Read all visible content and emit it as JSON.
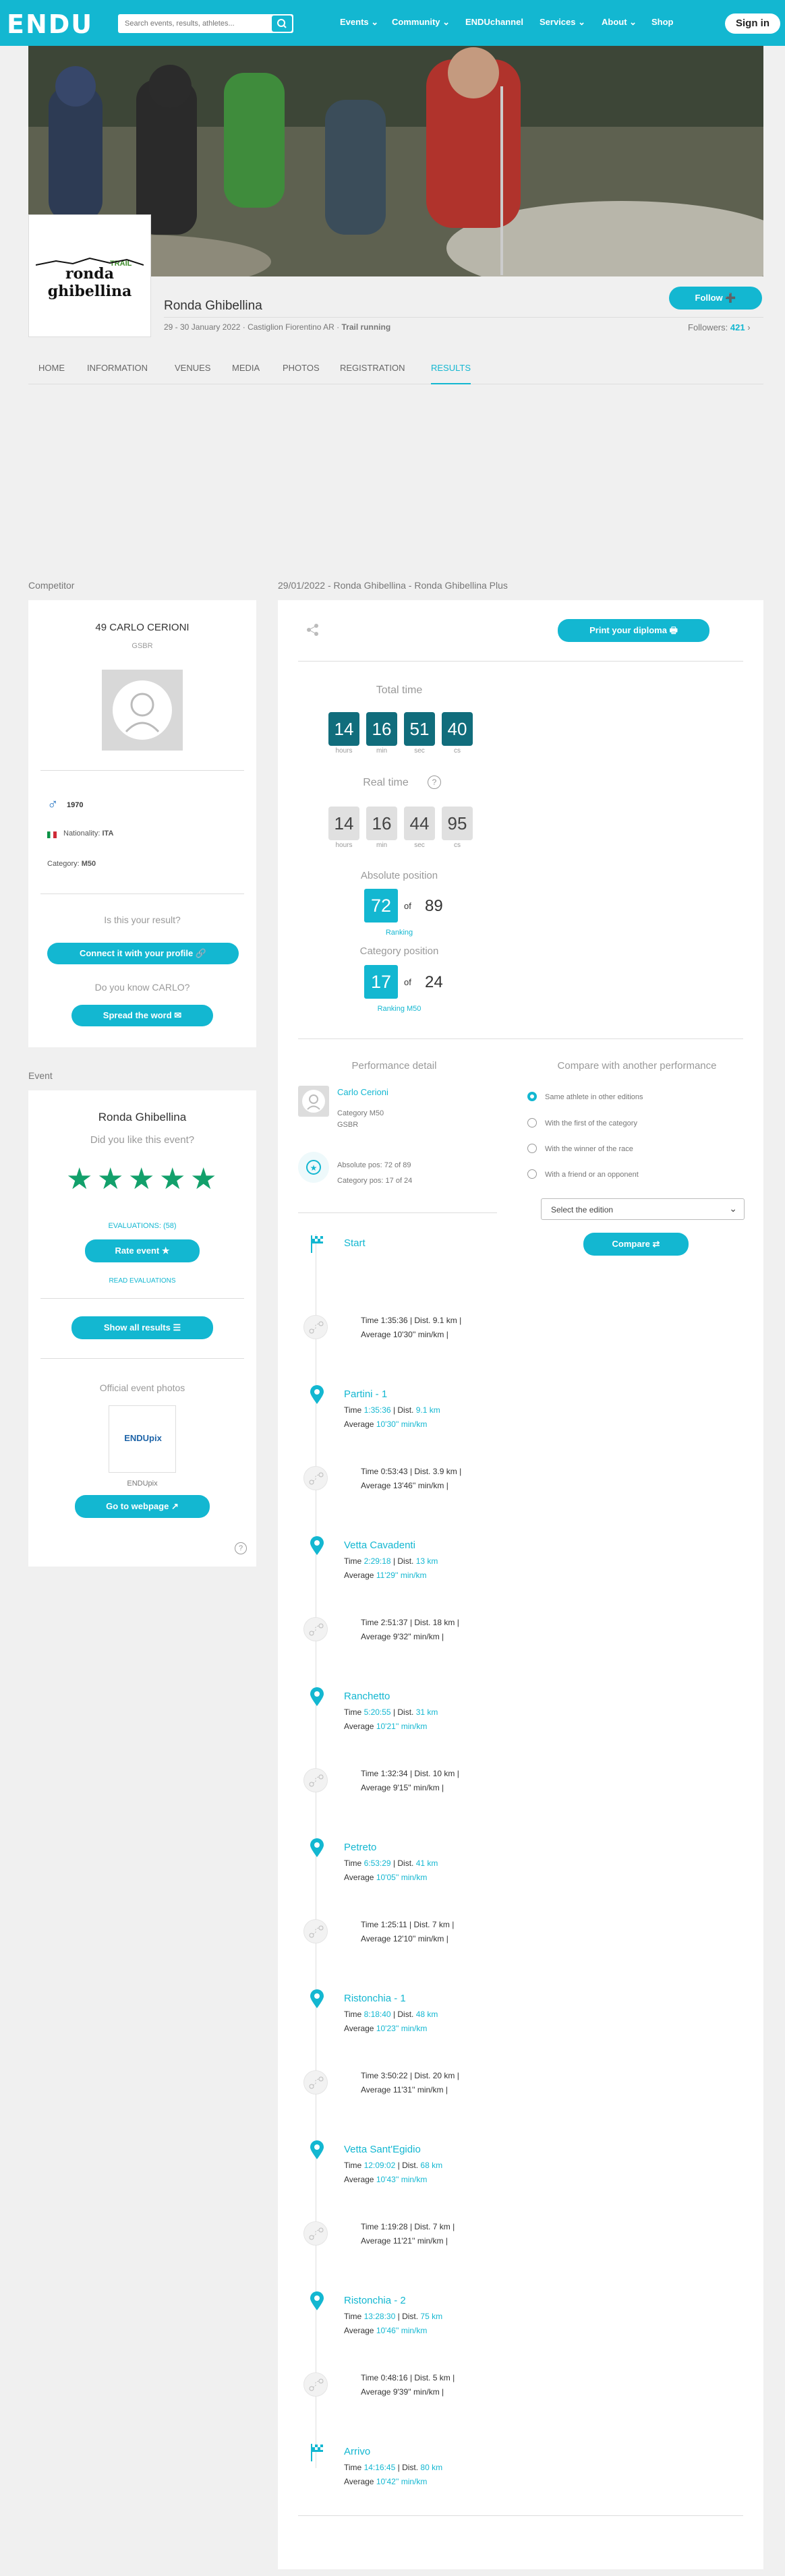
{
  "header": {
    "logo": "ENDU",
    "search_placeholder": "Search events, results, athletes...",
    "nav": [
      "Events",
      "Community",
      "ENDUchannel",
      "Services",
      "About",
      "Shop"
    ],
    "signin": "Sign in"
  },
  "event": {
    "logo_text": "ronda ghibellina",
    "logo_tag": "TRAIL",
    "title": "Ronda Ghibellina",
    "subtitle_prefix": "29 - 30 January 2022 · Castiglion Fiorentino AR · ",
    "subtitle_sport": "Trail running",
    "follow": "Follow",
    "followers_label": "Followers:",
    "followers_count": "421"
  },
  "tabs": [
    "HOME",
    "INFORMATION",
    "VENUES",
    "MEDIA",
    "PHOTOS",
    "REGISTRATION",
    "RESULTS"
  ],
  "competitor": {
    "section": "Competitor",
    "name": "49 CARLO CERIONI",
    "team": "GSBR",
    "year": "1970",
    "nationality_label": "Nationality:",
    "nationality": "ITA",
    "category_label": "Category:",
    "category": "M50",
    "is_your_result": "Is this your result?",
    "connect": "Connect it with your profile",
    "know": "Do you know CARLO?",
    "spread": "Spread the word"
  },
  "event_box": {
    "section": "Event",
    "title": "Ronda Ghibellina",
    "like": "Did you like this event?",
    "evaluations": "EVALUATIONS: (58)",
    "rate": "Rate event",
    "read": "READ EVALUATIONS",
    "show_all": "Show all results",
    "photos": "Official event photos",
    "endupix": "ENDUpix",
    "goto": "Go to webpage",
    "rating": 5
  },
  "result": {
    "header": "29/01/2022 - Ronda Ghibellina - Ronda Ghibellina Plus",
    "print": "Print your diploma",
    "total_time": "Total time",
    "total": [
      "14",
      "16",
      "51",
      "40"
    ],
    "units": [
      "hours",
      "min",
      "sec",
      "cs"
    ],
    "real_time": "Real time",
    "real": [
      "14",
      "16",
      "44",
      "95"
    ],
    "abs_label": "Absolute position",
    "abs_pos": "72",
    "of": "of",
    "abs_total": "89",
    "ranking": "Ranking",
    "cat_label": "Category position",
    "cat_pos": "17",
    "cat_total": "24",
    "ranking_cat": "Ranking M50"
  },
  "performance": {
    "title": "Performance detail",
    "name": "Carlo Cerioni",
    "category": "Category M50",
    "team": "GSBR",
    "abs": "Absolute pos: 72 of 89",
    "cat": "Category pos: 17 of 24"
  },
  "compare": {
    "title": "Compare with another performance",
    "options": [
      "Same athlete in other editions",
      "With the first of the category",
      "With the winner of the race",
      "With a friend or an opponent"
    ],
    "select": "Select the edition",
    "button": "Compare"
  },
  "checkpoints": [
    {
      "name": "Start"
    },
    {
      "name": "Partini - 1",
      "time": "1:35:36",
      "dist": "9.1 km",
      "avg": "10'30'' min/km"
    },
    {
      "name": "Vetta Cavadenti",
      "time": "2:29:18",
      "dist": "13 km",
      "avg": "11'29'' min/km"
    },
    {
      "name": "Ranchetto",
      "time": "5:20:55",
      "dist": "31 km",
      "avg": "10'21'' min/km"
    },
    {
      "name": "Petreto",
      "time": "6:53:29",
      "dist": "41 km",
      "avg": "10'05'' min/km"
    },
    {
      "name": "Ristonchia - 1",
      "time": "8:18:40",
      "dist": "48 km",
      "avg": "10'23'' min/km"
    },
    {
      "name": "Vetta Sant'Egidio",
      "time": "12:09:02",
      "dist": "68 km",
      "avg": "10'43'' min/km"
    },
    {
      "name": "Ristonchia - 2",
      "time": "13:28:30",
      "dist": "75 km",
      "avg": "10'46'' min/km"
    },
    {
      "name": "Arrivo",
      "time": "14:16:45",
      "dist": "80 km",
      "avg": "10'42'' min/km"
    }
  ],
  "segments": [
    {
      "time": "1:35:36",
      "dist": "9.1 km",
      "avg": "10'30'' min/km"
    },
    {
      "time": "0:53:43",
      "dist": "3.9 km",
      "avg": "13'46'' min/km"
    },
    {
      "time": "2:51:37",
      "dist": "18 km",
      "avg": "9'32'' min/km"
    },
    {
      "time": "1:32:34",
      "dist": "10 km",
      "avg": "9'15'' min/km"
    },
    {
      "time": "1:25:11",
      "dist": "7 km",
      "avg": "12'10'' min/km"
    },
    {
      "time": "3:50:22",
      "dist": "20 km",
      "avg": "11'31'' min/km"
    },
    {
      "time": "1:19:28",
      "dist": "7 km",
      "avg": "11'21'' min/km"
    },
    {
      "time": "0:48:16",
      "dist": "5 km",
      "avg": "9'39'' min/km"
    }
  ],
  "labels": {
    "time": "Time",
    "dist": "Dist.",
    "avg": "Average"
  }
}
